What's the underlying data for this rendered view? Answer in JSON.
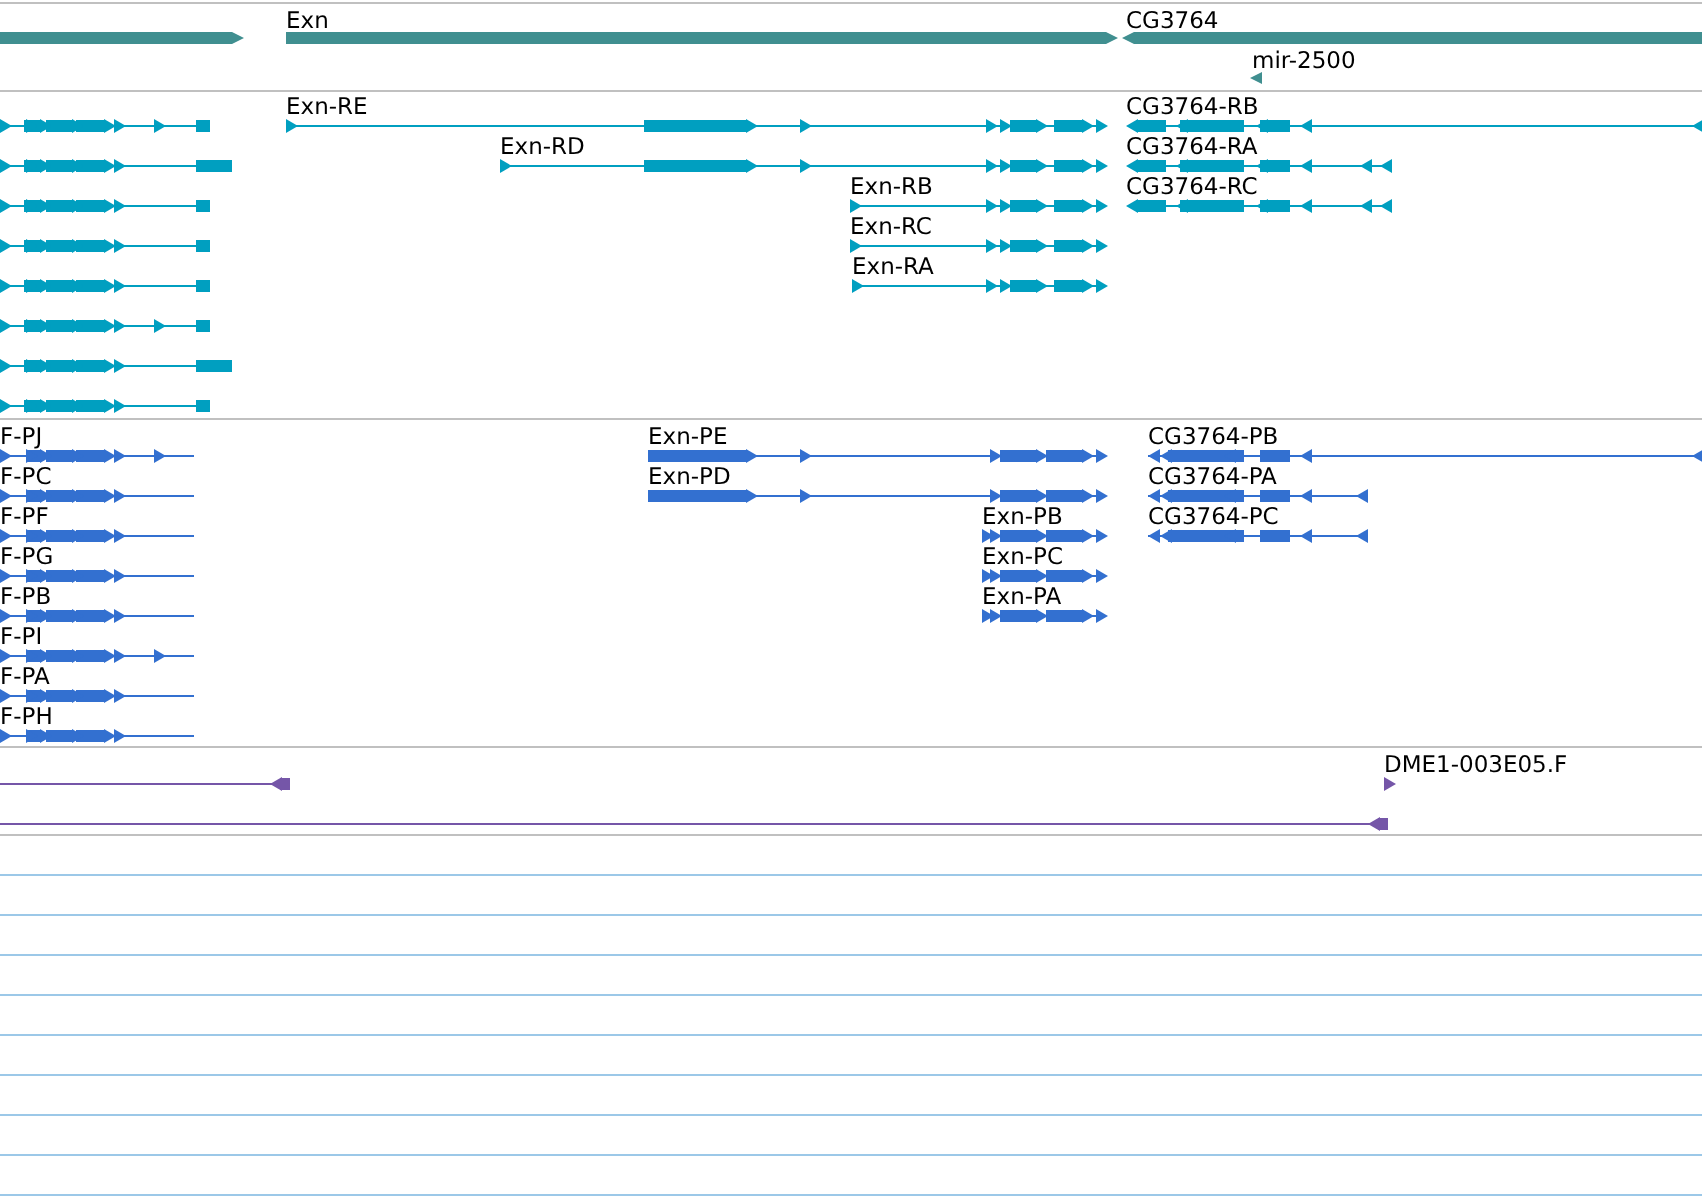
{
  "tracks": [
    {
      "kind": "gene",
      "features": [
        {
          "reverse": false
        },
        {
          "label": "Exn",
          "reverse": false
        },
        {
          "label": "CG3764",
          "reverse": true
        },
        {
          "label": "mir-2500",
          "reverse": true
        }
      ]
    },
    {
      "kind": "transcript",
      "features": [
        {
          "reverse": false
        },
        {
          "reverse": false
        },
        {
          "reverse": false
        },
        {
          "reverse": false
        },
        {
          "reverse": false
        },
        {
          "reverse": false
        },
        {
          "reverse": false
        },
        {
          "reverse": false
        },
        {
          "label": "Exn-RE",
          "reverse": false
        },
        {
          "label": "Exn-RD",
          "reverse": false
        },
        {
          "label": "Exn-RB",
          "reverse": false
        },
        {
          "label": "Exn-RC",
          "reverse": false
        },
        {
          "label": "Exn-RA",
          "reverse": false
        },
        {
          "label": "CG3764-RB",
          "reverse": true
        },
        {
          "label": "CG3764-RA",
          "reverse": true
        },
        {
          "label": "CG3764-RC",
          "reverse": true
        }
      ]
    },
    {
      "kind": "protein",
      "features": [
        {
          "label": "F-PJ",
          "reverse": false
        },
        {
          "label": "F-PC",
          "reverse": false
        },
        {
          "label": "F-PF",
          "reverse": false
        },
        {
          "label": "F-PG",
          "reverse": false
        },
        {
          "label": "F-PB",
          "reverse": false
        },
        {
          "label": "F-PI",
          "reverse": false
        },
        {
          "label": "F-PA",
          "reverse": false
        },
        {
          "label": "F-PH",
          "reverse": false
        },
        {
          "label": "Exn-PE",
          "reverse": false
        },
        {
          "label": "Exn-PD",
          "reverse": false
        },
        {
          "label": "Exn-PB",
          "reverse": false
        },
        {
          "label": "Exn-PC",
          "reverse": false
        },
        {
          "label": "Exn-PA",
          "reverse": false
        },
        {
          "label": "CG3764-PB",
          "reverse": true
        },
        {
          "label": "CG3764-PA",
          "reverse": true
        },
        {
          "label": "CG3764-PC",
          "reverse": true
        }
      ]
    },
    {
      "kind": "est",
      "features": [
        {
          "reverse": true
        },
        {
          "label": "DME1-003E05.F",
          "reverse": false
        },
        {
          "reverse": true
        }
      ]
    }
  ]
}
